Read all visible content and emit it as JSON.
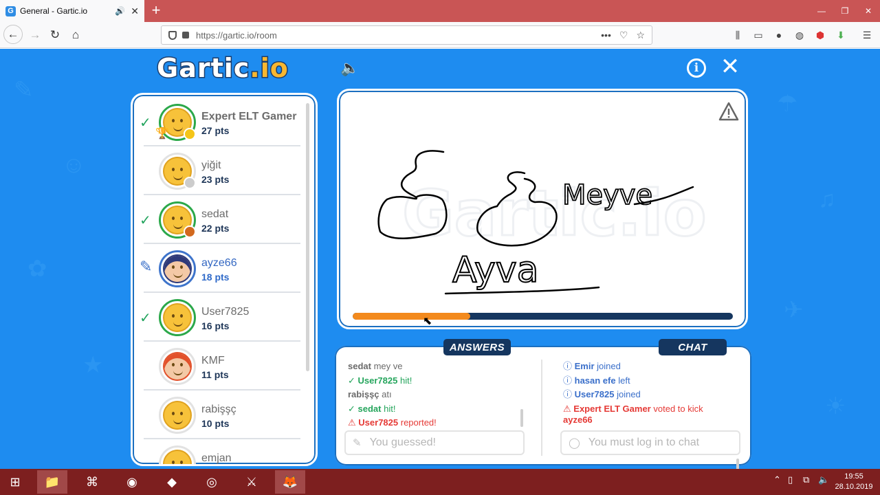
{
  "browser": {
    "tab_title": "General - Gartic.io",
    "favicon_letter": "G",
    "url": "https://gartic.io/room"
  },
  "game": {
    "logo_text": "Gartic",
    "logo_suffix": ".io",
    "players": [
      {
        "name": "Expert ELT Gamer",
        "points": "27 pts",
        "status": "guessed",
        "badge_color": "#f5c518",
        "trophy": true
      },
      {
        "name": "yiğit",
        "points": "23 pts",
        "status": "none",
        "badge_color": "#cccccc"
      },
      {
        "name": "sedat",
        "points": "22 pts",
        "status": "guessed",
        "badge_color": "#d2691e"
      },
      {
        "name": "ayze66",
        "points": "18 pts",
        "status": "drawing"
      },
      {
        "name": "User7825",
        "points": "16 pts",
        "status": "guessed"
      },
      {
        "name": "KMF",
        "points": "11 pts",
        "status": "none"
      },
      {
        "name": "rabişşç",
        "points": "10 pts",
        "status": "none"
      },
      {
        "name": "emjan",
        "points": "",
        "status": "none"
      }
    ],
    "drawing_words": [
      "Meyve",
      "Ayva"
    ],
    "timer_progress": 0.31,
    "answers_label": "ANSWERS",
    "chat_label": "CHAT",
    "answers": [
      {
        "who": "sedat",
        "text": "mey ve",
        "type": "message"
      },
      {
        "who": "User7825",
        "text": "hit!",
        "type": "hit"
      },
      {
        "who": "rabişşç",
        "text": "atı",
        "type": "message"
      },
      {
        "who": "sedat",
        "text": "hit!",
        "type": "hit"
      },
      {
        "who": "User7825",
        "text": "reported!",
        "type": "report"
      }
    ],
    "chat": [
      {
        "who": "Emir",
        "text": "joined",
        "type": "info"
      },
      {
        "who": "hasan efe",
        "text": "left",
        "type": "info"
      },
      {
        "who": "User7825",
        "text": "joined",
        "type": "info"
      },
      {
        "who": "Expert ELT Gamer",
        "text": "voted to kick",
        "type": "kick"
      },
      {
        "who": "ayze66",
        "text": "",
        "type": "kick_target"
      }
    ],
    "answer_placeholder": "You guessed!",
    "chat_placeholder": "You must log in to chat"
  },
  "taskbar": {
    "time": "19:55",
    "date": "28.10.2019"
  },
  "colors": {
    "game_bg": "#1e8cf0",
    "navy": "#15365f",
    "timer_orange": "#f38a1d",
    "guess_green": "#25a55c",
    "report_red": "#e53935",
    "info_blue": "#3a6fca"
  }
}
